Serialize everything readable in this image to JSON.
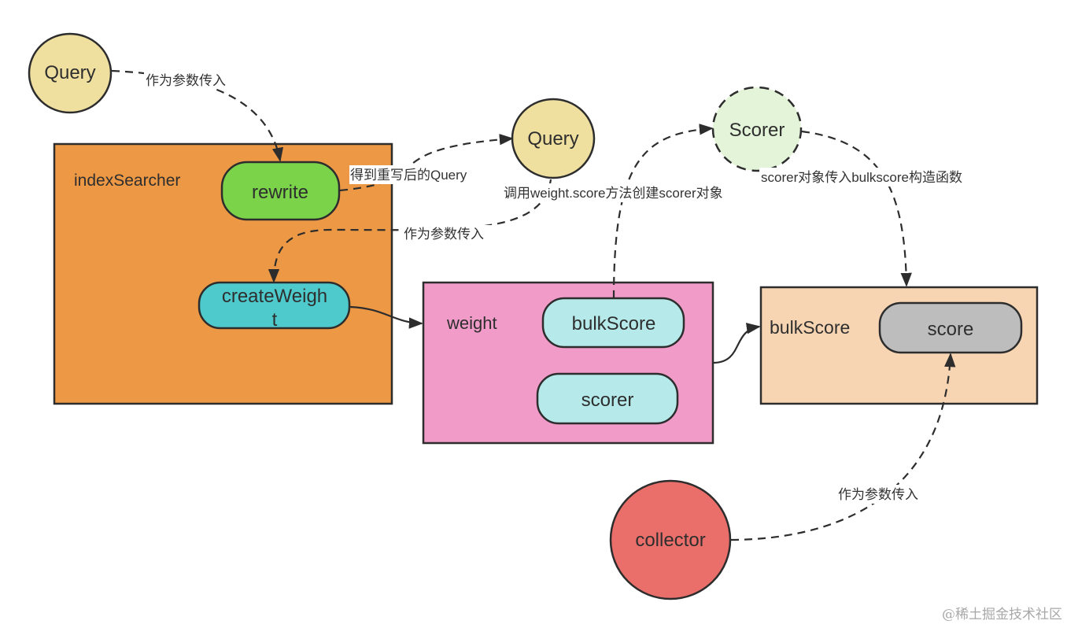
{
  "nodes": {
    "query_input": {
      "label": "Query",
      "shape": "circle",
      "fill": "#f0e0a0"
    },
    "index_searcher": {
      "label": "indexSearcher",
      "shape": "rect",
      "fill": "#ec9844"
    },
    "rewrite": {
      "label": "rewrite",
      "shape": "pill",
      "fill": "#7bd34a"
    },
    "create_weight": {
      "label_line1": "createWeigh",
      "label_line2": "t",
      "shape": "pill",
      "fill": "#4ecacd"
    },
    "query_rewritten": {
      "label": "Query",
      "shape": "circle",
      "fill": "#f0e0a0"
    },
    "scorer_obj": {
      "label": "Scorer",
      "shape": "dashed-circle",
      "fill": "#e3f4d9"
    },
    "weight": {
      "label": "weight",
      "shape": "rect",
      "fill": "#f09bc8"
    },
    "weight_bulk_score": {
      "label": "bulkScore",
      "shape": "pill",
      "fill": "#b5e9ea"
    },
    "weight_scorer": {
      "label": "scorer",
      "shape": "pill",
      "fill": "#b5e9ea"
    },
    "bulk_score": {
      "label": "bulkScore",
      "shape": "rect",
      "fill": "#f7d5b3"
    },
    "score": {
      "label": "score",
      "shape": "pill",
      "fill": "#bdbdbd"
    },
    "collector": {
      "label": "collector",
      "shape": "circle",
      "fill": "#ea6f6b"
    }
  },
  "edges": {
    "query_to_rewrite": {
      "label": "作为参数传入",
      "style": "dashed"
    },
    "rewrite_to_query": {
      "label": "得到重写后的Query",
      "style": "dashed"
    },
    "query_to_create_weight": {
      "label": "作为参数传入",
      "style": "dashed"
    },
    "create_weight_to_weight": {
      "label": "",
      "style": "solid"
    },
    "bulk_score_to_scorer": {
      "label": "调用weight.score方法创建scorer对象",
      "style": "dashed"
    },
    "scorer_to_bulk_score": {
      "label": "scorer对象传入bulkscore构造函数",
      "style": "dashed"
    },
    "weight_to_bulk_score": {
      "label": "",
      "style": "solid"
    },
    "collector_to_score": {
      "label": "作为参数传入",
      "style": "dashed"
    }
  },
  "colors": {
    "stroke": "#2d2d2d",
    "edge": "#2d2d2d"
  },
  "watermark": "@稀土掘金技术社区"
}
